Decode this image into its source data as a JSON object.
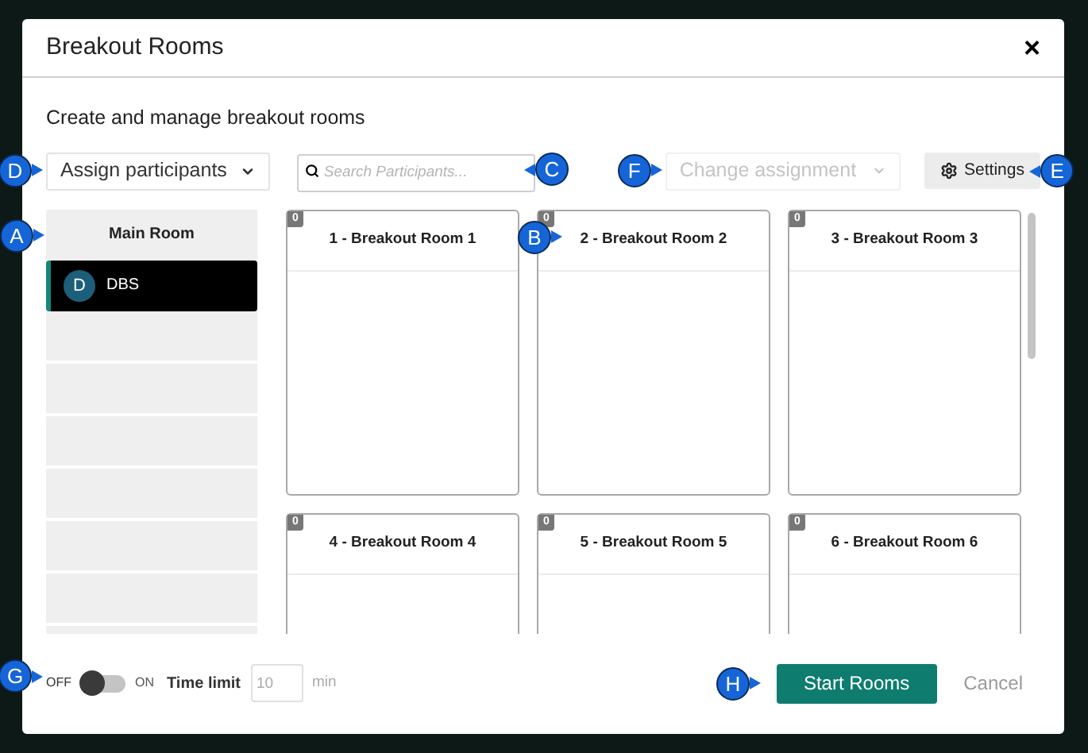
{
  "dialog": {
    "title": "Breakout Rooms",
    "close": "×"
  },
  "subtitle": "Create and manage breakout rooms",
  "toolbar": {
    "assign": {
      "label": "Assign participants",
      "callout": "D"
    },
    "search": {
      "placeholder": "Search Participants...",
      "callout": "C"
    },
    "change": {
      "label": "Change assignment",
      "disabled": true,
      "callout": "F"
    },
    "settings": {
      "label": "Settings",
      "callout": "E"
    }
  },
  "main_room": {
    "title": "Main Room",
    "callout": "A",
    "participants": [
      {
        "initial": "D",
        "name": "DBS",
        "selected": true
      }
    ]
  },
  "rooms": [
    {
      "name": "1 - Breakout Room 1",
      "count": "0"
    },
    {
      "name": "2 - Breakout Room 2",
      "count": "0",
      "callout": "B"
    },
    {
      "name": "3 - Breakout Room 3",
      "count": "0"
    },
    {
      "name": "4 - Breakout Room 4",
      "count": "0"
    },
    {
      "name": "5 - Breakout Room 5",
      "count": "0"
    },
    {
      "name": "6 - Breakout Room 6",
      "count": "0"
    }
  ],
  "footer": {
    "off_label": "OFF",
    "on_label": "ON",
    "timer_on": false,
    "time_limit_label": "Time limit",
    "time_limit": "10",
    "unit": "min",
    "toggle_callout": "G",
    "start": {
      "label": "Start Rooms",
      "callout": "H"
    },
    "cancel": "Cancel"
  }
}
